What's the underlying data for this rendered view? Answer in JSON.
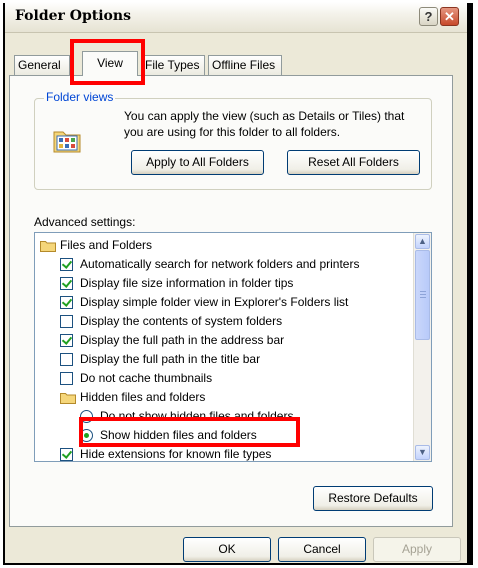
{
  "window": {
    "title": "Folder Options",
    "help_glyph": "?",
    "close_glyph": "✕"
  },
  "tabs": [
    {
      "label": "General"
    },
    {
      "label": "View"
    },
    {
      "label": "File Types"
    },
    {
      "label": "Offline Files"
    }
  ],
  "folder_views": {
    "label": "Folder views",
    "description": "You can apply the view (such as Details or Tiles) that you are using for this folder to all folders.",
    "apply_button": "Apply to All Folders",
    "reset_button": "Reset All Folders"
  },
  "advanced": {
    "label": "Advanced settings:",
    "items": [
      {
        "type": "folder",
        "label": "Files and Folders"
      },
      {
        "type": "checkbox",
        "checked": true,
        "label": "Automatically search for network folders and printers"
      },
      {
        "type": "checkbox",
        "checked": true,
        "label": "Display file size information in folder tips"
      },
      {
        "type": "checkbox",
        "checked": true,
        "label": "Display simple folder view in Explorer's Folders list"
      },
      {
        "type": "checkbox",
        "checked": false,
        "label": "Display the contents of system folders"
      },
      {
        "type": "checkbox",
        "checked": true,
        "label": "Display the full path in the address bar"
      },
      {
        "type": "checkbox",
        "checked": false,
        "label": "Display the full path in the title bar"
      },
      {
        "type": "checkbox",
        "checked": false,
        "label": "Do not cache thumbnails"
      },
      {
        "type": "folder",
        "label": "Hidden files and folders"
      },
      {
        "type": "radio",
        "checked": false,
        "label": "Do not show hidden files and folders"
      },
      {
        "type": "radio",
        "checked": true,
        "label": "Show hidden files and folders"
      },
      {
        "type": "checkbox",
        "checked": true,
        "label": "Hide extensions for known file types"
      }
    ],
    "restore_button": "Restore Defaults"
  },
  "footer": {
    "ok": "OK",
    "cancel": "Cancel",
    "apply": "Apply"
  },
  "colors": {
    "highlight": "#ff0000",
    "group_label": "#0046d5",
    "check": "#21a121"
  },
  "icons": [
    "help-icon",
    "close-icon",
    "folder-view-icon",
    "folder-icon",
    "scroll-up-icon",
    "scroll-down-icon"
  ]
}
